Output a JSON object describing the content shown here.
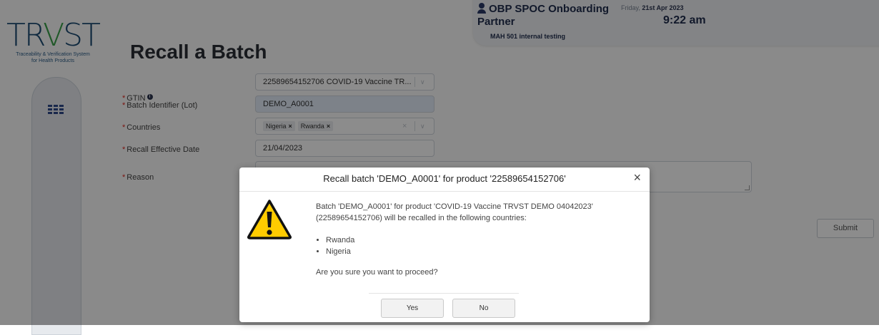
{
  "logo": {
    "word_start": "TR",
    "word_v": "V",
    "word_end": "ST",
    "subtitle_line1": "Traceability & Verification System",
    "subtitle_line2": "for Health Products"
  },
  "header": {
    "user_name": "OBP SPOC Onboarding Partner",
    "organization": "MAH 501 internal testing",
    "day": "Friday,",
    "date": "21st Apr 2023",
    "time": "9:22 am"
  },
  "page": {
    "title": "Recall a Batch"
  },
  "form": {
    "gtin_label": "GTIN",
    "gtin_value": "22589654152706 COVID-19 Vaccine TR...",
    "batch_label": "Batch Identifier (Lot)",
    "batch_value": "DEMO_A0001",
    "countries_label": "Countries",
    "countries": [
      "Nigeria",
      "Rwanda"
    ],
    "date_label": "Recall Effective Date",
    "date_value": "21/04/2023",
    "reason_label": "Reason",
    "reason_value": "",
    "submit_label": "Submit",
    "required_mark": "*"
  },
  "modal": {
    "title": "Recall batch 'DEMO_A0001' for product '22589654152706'",
    "message": "Batch 'DEMO_A0001' for product 'COVID-19 Vaccine TRVST DEMO 04042023' (22589654152706) will be recalled in the following countries:",
    "countries": [
      "Rwanda",
      "Nigeria"
    ],
    "question": "Are you sure you want to proceed?",
    "yes_label": "Yes",
    "no_label": "No",
    "close_symbol": "×"
  },
  "icons": {
    "user": "user-icon",
    "menu": "menu-grid-icon",
    "info": "info-icon",
    "warning": "warning-icon",
    "close": "close-icon"
  },
  "colors": {
    "required": "#e0261d",
    "brand_blue": "#1c4c74",
    "brand_green": "#3aa14a",
    "warning_yellow": "#ffcc00"
  }
}
